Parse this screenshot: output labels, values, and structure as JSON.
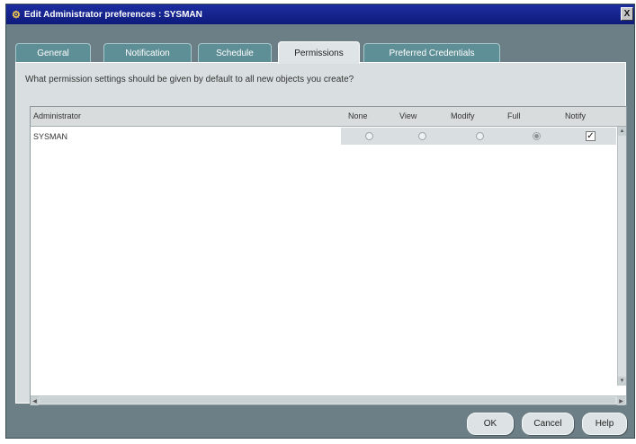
{
  "window": {
    "title": "Edit Administrator preferences : SYSMAN",
    "close_glyph": "X"
  },
  "tabs": [
    {
      "label": "General",
      "active": false
    },
    {
      "label": "Notification",
      "active": false
    },
    {
      "label": "Schedule",
      "active": false
    },
    {
      "label": "Permissions",
      "active": true
    },
    {
      "label": "Preferred Credentials",
      "active": false
    }
  ],
  "panel": {
    "question": "What permission settings should be given by default to all new objects you create?"
  },
  "table": {
    "columns": [
      "Administrator",
      "None",
      "View",
      "Modify",
      "Full",
      "Notify"
    ],
    "rows": [
      {
        "administrator": "SYSMAN",
        "permission": "Full",
        "notify": true,
        "notify_glyph": "✓"
      }
    ]
  },
  "buttons": {
    "ok": "OK",
    "cancel": "Cancel",
    "help": "Help"
  },
  "icons": {
    "app": "app-icon",
    "scroll_up": "arrow-up-icon",
    "scroll_down": "arrow-down-icon",
    "scroll_left": "arrow-left-icon",
    "scroll_right": "arrow-right-icon"
  }
}
